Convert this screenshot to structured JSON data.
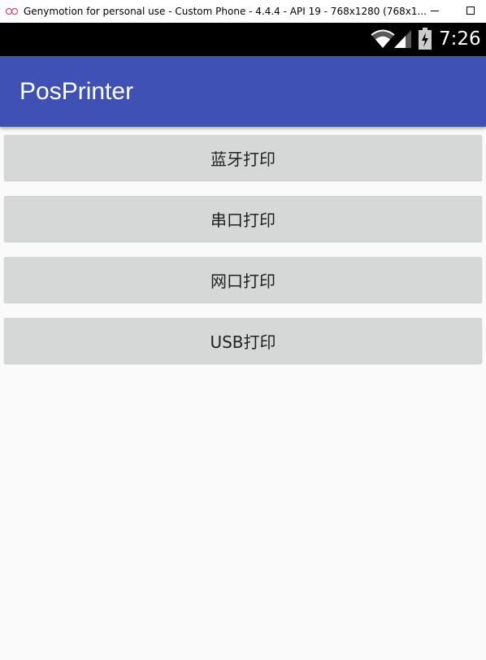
{
  "window": {
    "title": "Genymotion for personal use - Custom Phone - 4.4.4 - API 19 - 768x1280 (768x1..."
  },
  "status_bar": {
    "time": "7:26",
    "icons": [
      "wifi-icon",
      "signal-icon",
      "battery-charging-icon"
    ]
  },
  "app_bar": {
    "title": "PosPrinter",
    "color": "#3f51b5"
  },
  "buttons": [
    {
      "label": "蓝牙打印"
    },
    {
      "label": "串口打印"
    },
    {
      "label": "网口打印"
    },
    {
      "label": "USB打印"
    }
  ],
  "colors": {
    "button_bg": "#d6d7d7",
    "background": "#fafafa"
  }
}
